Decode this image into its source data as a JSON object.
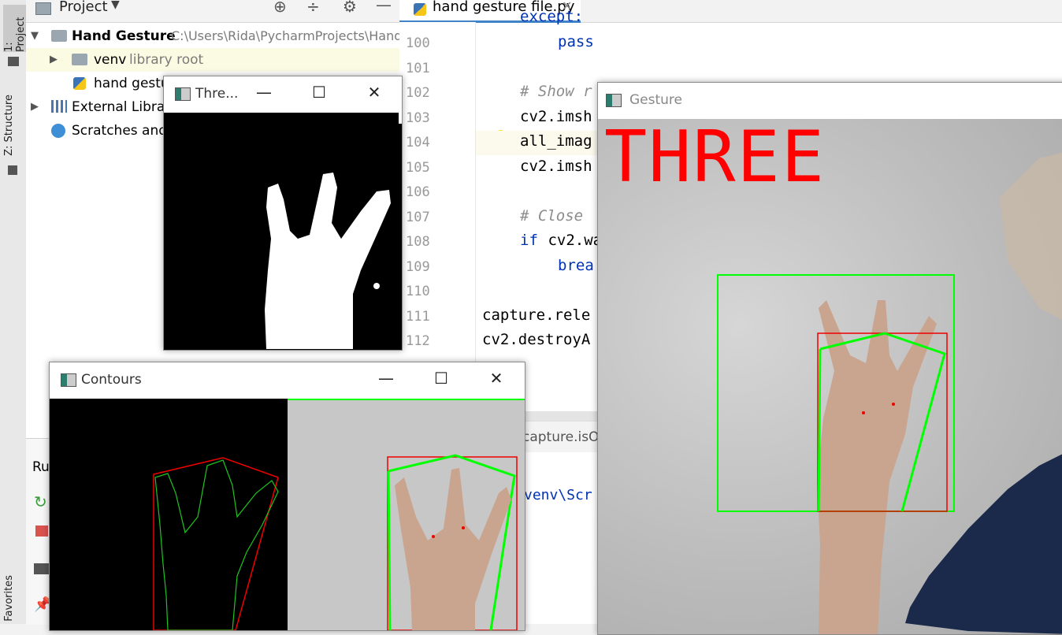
{
  "sidebar": {
    "project_tab": "1: Project",
    "structure_tab": "Z: Structure",
    "favorites_tab": "Favorites"
  },
  "project_panel": {
    "title": "Project",
    "root": {
      "name": "Hand Gesture",
      "path": "C:\\Users\\Rida\\PycharmProjects\\Hand"
    },
    "venv": {
      "name": "venv",
      "hint": "library root"
    },
    "file": "hand gestu",
    "external": "External Librari",
    "scratches": "Scratches and"
  },
  "editor": {
    "tab": "hand gesture file.py",
    "line_numbers": [
      "100",
      "101",
      "102",
      "103",
      "104",
      "105",
      "106",
      "107",
      "108",
      "109",
      "110",
      "111",
      "112"
    ],
    "lines": {
      "l99": "except:",
      "l100": "pass",
      "l102": "# Show r",
      "l103": "cv2.imsh",
      "l104": "all_imag",
      "l105": "cv2.imsh",
      "l107": "# Close",
      "l108_kw": "if",
      "l108": " cv2.wa",
      "l109": "brea",
      "l111": "capture.rele",
      "l112": "cv2.destroyA"
    },
    "breadcrumb": "capture.isOp",
    "run_label": "Ru",
    "run_output": "venv\\Scr"
  },
  "windows": {
    "threshold": {
      "title": "Thre..."
    },
    "contours": {
      "title": "Contours"
    },
    "gesture": {
      "title": "Gesture",
      "overlay": "THREE"
    }
  },
  "colors": {
    "overlay_text": "#ff0000",
    "hull": "#00ff00",
    "bbox": "#ff0000"
  }
}
